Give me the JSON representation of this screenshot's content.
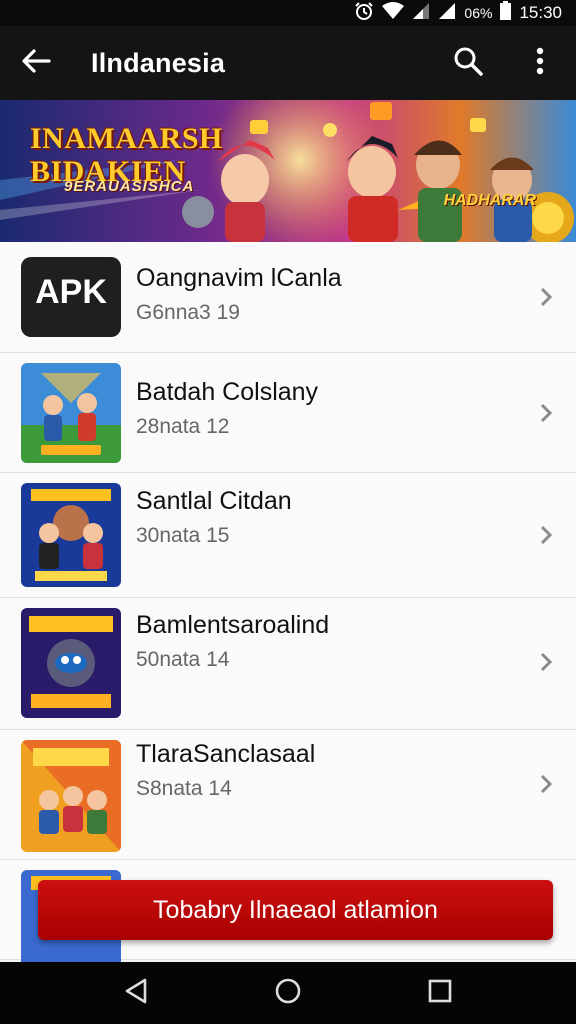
{
  "status_bar": {
    "battery_pct": "06%",
    "time": "15:30",
    "icons": [
      "alarm-icon",
      "wifi-icon",
      "signal-icon",
      "signal-icon",
      "battery-icon"
    ]
  },
  "app_bar": {
    "title": "Ilndanesia",
    "back_icon": "arrow-left-icon",
    "search_icon": "search-icon",
    "more_icon": "more-vert-icon"
  },
  "banner": {
    "title_line1": "INAMAARSH",
    "title_line2": "BIDAKIEN",
    "tagline": "9ERAUASISHCA",
    "badge": "HADHARAR"
  },
  "list": {
    "items": [
      {
        "title": "Oangnavim lCanla",
        "subtitle": "G6nna3 19",
        "thumb": "apk-icon",
        "thumb_text": "APK"
      },
      {
        "title": "Batdah Colslany",
        "subtitle": "28nata 12",
        "thumb": "game-art"
      },
      {
        "title": "Santlal Citdan",
        "subtitle": "30nata 15",
        "thumb": "game-art"
      },
      {
        "title": "Bamlentsaroalind",
        "subtitle": "50nata 14",
        "thumb": "game-art"
      },
      {
        "title": "TlaraSanclasaal",
        "subtitle": "S8nata 14",
        "thumb": "game-art"
      }
    ]
  },
  "cta": {
    "label": "Tobabry Ilnaeaol atlamion"
  },
  "nav_bar": {
    "icons": [
      "back-triangle-icon",
      "home-circle-icon",
      "recents-square-icon"
    ]
  },
  "colors": {
    "accent": "#c20000",
    "app_bar": "#141414",
    "background": "#fafafa"
  }
}
